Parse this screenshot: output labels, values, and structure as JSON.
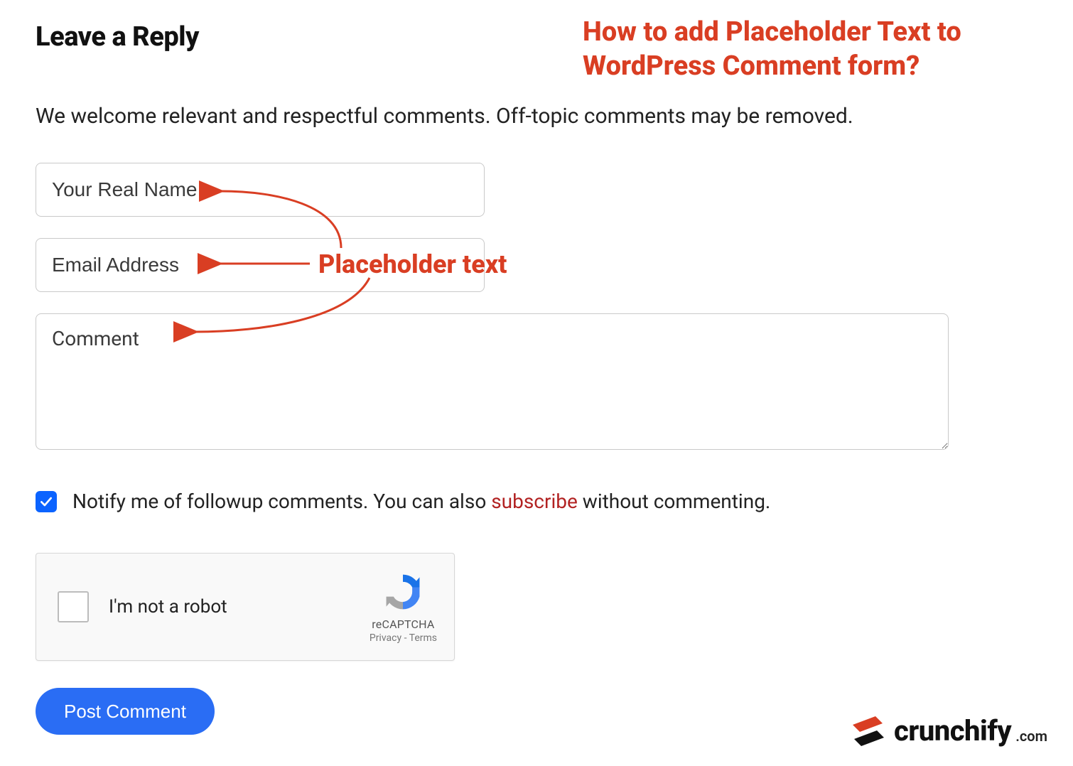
{
  "heading": "Leave a Reply",
  "annotation": {
    "title": "How to add Placeholder Text to WordPress Comment form?",
    "label": "Placeholder text"
  },
  "intro": "We welcome relevant and respectful comments. Off-topic comments may be removed.",
  "form": {
    "name_placeholder": "Your Real Name",
    "email_placeholder": "Email Address",
    "comment_placeholder": "Comment"
  },
  "notify": {
    "checked": true,
    "text_before": "Notify me of followup comments. You can also ",
    "link_text": "subscribe",
    "text_after": " without commenting."
  },
  "recaptcha": {
    "label": "I'm not a robot",
    "brand": "reCAPTCHA",
    "privacy": "Privacy",
    "sep": " - ",
    "terms": "Terms"
  },
  "submit_label": "Post Comment",
  "brand": {
    "name": "crunchify",
    "suffix": ".com"
  },
  "colors": {
    "accent_red": "#d93e23",
    "button_blue": "#2a6df4",
    "checkbox_blue": "#0b63ff",
    "link_red": "#b22222"
  }
}
